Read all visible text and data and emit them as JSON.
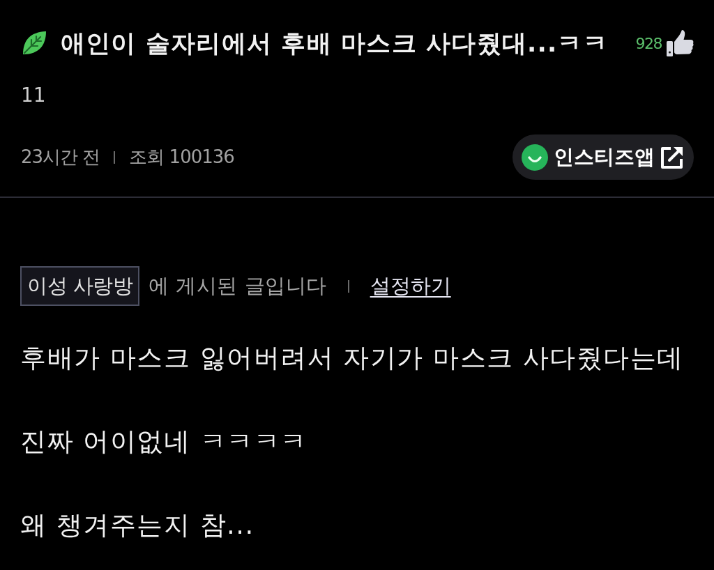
{
  "post": {
    "title": "애인이 술자리에서 후배 마스크 사다줬대...ㅋㅋ",
    "likes": "928",
    "title_count": "11",
    "time": "23시간 전",
    "views": "조회 100136"
  },
  "app_button": {
    "label": "인스티즈앱"
  },
  "board": {
    "name": "이성 사랑방",
    "text": "에 게시된 글입니다",
    "link": "설정하기"
  },
  "body": [
    "후배가 마스크 잃어버려서 자기가 마스크 사다줬다는데",
    "진짜 어이없네 ㅋㅋㅋㅋ",
    "왜 챙겨주는지 참..."
  ]
}
